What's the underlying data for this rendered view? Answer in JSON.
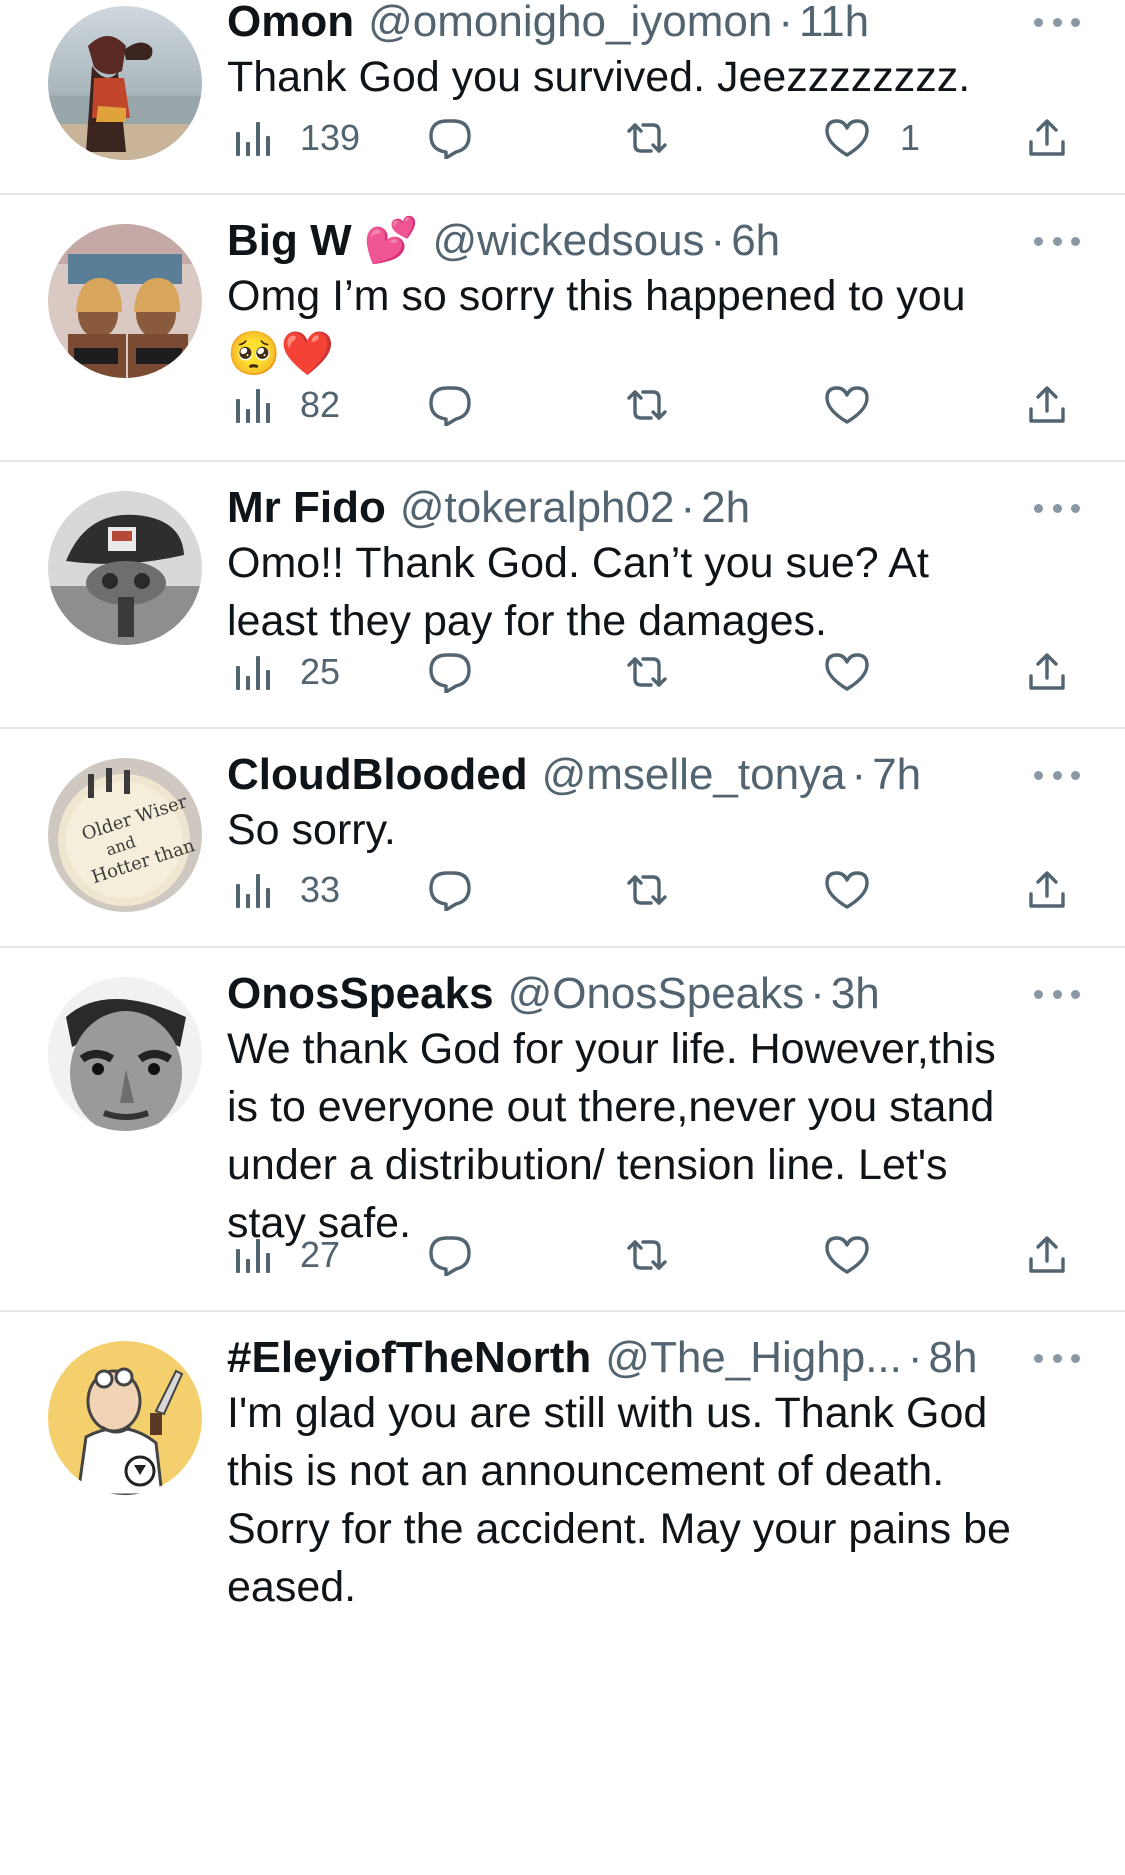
{
  "tweets": [
    {
      "name": "Omon",
      "name_emoji": "",
      "handle": "@omonigho_iyomon",
      "separator": "·",
      "time": "11h",
      "lines": [
        "Thank God you survived. Jeezzzzzzzz."
      ],
      "views": "139",
      "likes": "1"
    },
    {
      "name": "Big W",
      "name_emoji": "💕",
      "handle": "@wickedsous",
      "separator": "·",
      "time": "6h",
      "lines": [
        "Omg I’m so sorry this happened to you",
        "🥺❤️"
      ],
      "views": "82",
      "likes": ""
    },
    {
      "name": "Mr Fido",
      "name_emoji": "",
      "handle": "@tokeralph02",
      "separator": "·",
      "time": "2h",
      "lines": [
        "Omo!! Thank God. Can’t you sue? At",
        "least they pay for the damages."
      ],
      "views": "25",
      "likes": ""
    },
    {
      "name": "CloudBlooded",
      "name_emoji": "",
      "handle": "@mselle_tonya",
      "separator": "·",
      "time": "7h",
      "lines": [
        "So sorry."
      ],
      "views": "33",
      "likes": ""
    },
    {
      "name": "OnosSpeaks",
      "name_emoji": "",
      "handle": "@OnosSpeaks",
      "separator": "·",
      "time": "3h",
      "lines": [
        "We thank God for your life. However,this",
        "is to everyone out there,never you stand",
        "under a distribution/ tension line. Let's",
        "stay safe."
      ],
      "views": "27",
      "likes": ""
    },
    {
      "name": "#EleyiofTheNorth",
      "name_emoji": "",
      "handle": "@The_Highp...",
      "separator": "·",
      "time": "8h",
      "lines": [
        "I'm glad you are still with us. Thank God",
        "this is not an announcement of death.",
        "Sorry for the accident. May your pains be",
        "eased."
      ],
      "views": "",
      "likes": ""
    }
  ],
  "colors": {
    "text": "#0f1419",
    "secondary": "#536471",
    "divider": "#e4e6e9"
  },
  "icons": {
    "views": "views-icon",
    "reply": "reply-icon",
    "retweet": "retweet-icon",
    "like": "like-icon",
    "share": "share-icon",
    "more": "more-icon"
  }
}
